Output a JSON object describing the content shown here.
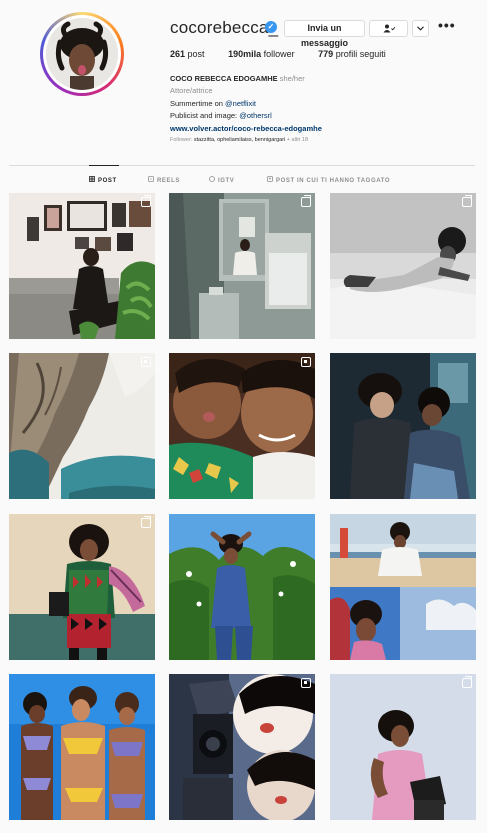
{
  "profile": {
    "username": "cocorebecca_",
    "message_label": "Invia un messaggio",
    "follow_icon": "person-check-icon",
    "more_icon": "ellipsis-icon",
    "stats": {
      "posts_value": "261",
      "posts_label": "post",
      "followers_value": "190mila",
      "followers_label": "follower",
      "following_value": "779",
      "following_label": "profili seguiti"
    },
    "bio": {
      "full_name": "COCO REBECCA EDOGAMHE",
      "pronouns": "she/her",
      "category": "Attore/attrice",
      "line1_text": "Summertime on ",
      "line1_mention": "@netflixit",
      "line2_text": "Publicist and image: ",
      "line2_mention": "@othersrl",
      "website": "www.volver.actor/coco-rebecca-edogamhe",
      "followed_by_label": "Follower: ",
      "followed_by_names": "stazzitta, opheliamilaiss, bennigargari",
      "followed_by_more": " + altri 18"
    }
  },
  "tabs": [
    {
      "label": "POST",
      "icon": "grid-icon",
      "active": true
    },
    {
      "label": "REELS",
      "icon": "reels-icon",
      "active": false
    },
    {
      "label": "IGTV",
      "icon": "igtv-icon",
      "active": false
    },
    {
      "label": "POST IN CUI TI HANNO TAGGATO",
      "icon": "tagged-icon",
      "active": false
    }
  ],
  "posts": [
    {
      "scene": "living room with framed pictures and plant",
      "badge": "multi"
    },
    {
      "scene": "mirror selfie in bathroom",
      "badge": "multi"
    },
    {
      "scene": "black and white photo lying on bed",
      "badge": "multi"
    },
    {
      "scene": "rocky cliff above sea",
      "badge": "igtv"
    },
    {
      "scene": "two friends selfie with green shirt",
      "badge": "igtv"
    },
    {
      "scene": "two friends at night",
      "badge": "none"
    },
    {
      "scene": "woman in colorful knit outfit",
      "badge": "multi"
    },
    {
      "scene": "woman among green plants under blue sky",
      "badge": "none"
    },
    {
      "scene": "collage of beach photos",
      "badge": "none"
    },
    {
      "scene": "three women in bikinis under blue sky",
      "badge": "none"
    },
    {
      "scene": "flash selfie with camera",
      "badge": "igtv"
    },
    {
      "scene": "woman in pink top against pale wall",
      "badge": "multi"
    }
  ]
}
